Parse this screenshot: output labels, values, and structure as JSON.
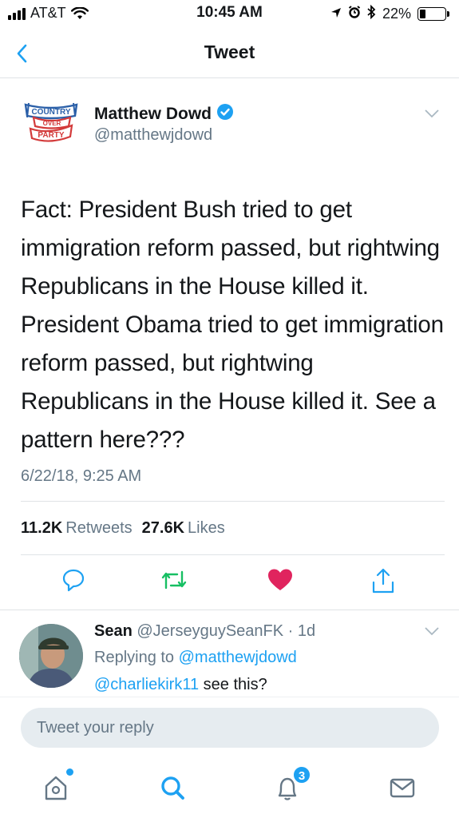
{
  "status_bar": {
    "carrier": "AT&T",
    "time": "10:45 AM",
    "battery": "22%",
    "battery_level": 0.22,
    "icons": [
      "signal-icon",
      "wifi-icon",
      "location-icon",
      "alarm-icon",
      "bluetooth-icon",
      "battery-icon"
    ]
  },
  "nav": {
    "title": "Tweet",
    "back_icon": "back-chevron-icon"
  },
  "tweet": {
    "author_name": "Matthew Dowd",
    "author_handle": "@matthewjdowd",
    "verified": true,
    "avatar_logo_text": [
      "COUNTRY",
      "OVER",
      "PARTY"
    ],
    "text": "Fact:  President Bush tried to get immigration reform passed, but rightwing Republicans in the House killed it.  President Obama tried to get immigration reform passed, but rightwing Republicans in the House killed it.  See a pattern here???",
    "timestamp": "6/22/18, 9:25 AM",
    "retweets_count": "11.2K",
    "retweets_label": "Retweets",
    "likes_count": "27.6K",
    "likes_label": "Likes",
    "liked": true,
    "colors": {
      "accent": "#1da1f2",
      "retweet": "#17bf63",
      "like": "#e0245e",
      "muted": "#657786"
    }
  },
  "reply": {
    "name": "Sean",
    "handle": "@JerseyguySeanFK",
    "age": "1d",
    "replying_prefix": "Replying to",
    "replying_to": "@matthewjdowd",
    "mention": "@charliekirk11",
    "text": "see this?"
  },
  "composer": {
    "placeholder": "Tweet your reply"
  },
  "tabbar": {
    "items": [
      {
        "name": "home",
        "icon": "home-icon",
        "has_dot": true
      },
      {
        "name": "search",
        "icon": "search-icon"
      },
      {
        "name": "notifications",
        "icon": "bell-icon",
        "badge": "3"
      },
      {
        "name": "messages",
        "icon": "mail-icon"
      }
    ]
  }
}
